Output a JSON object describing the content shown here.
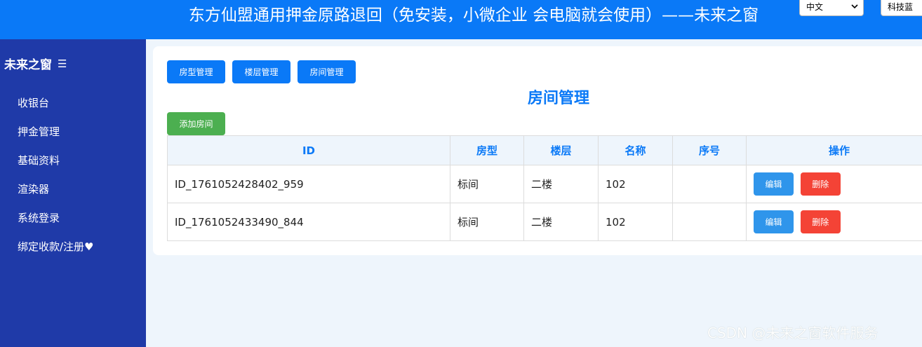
{
  "header": {
    "title": "东方仙盟通用押金原路退回（免安装，小微企业 会电脑就会使用）——未来之窗",
    "language_value": "中文",
    "theme_label": "科技蓝"
  },
  "sidebar": {
    "brand": "未来之窗",
    "menu_icon": "☰",
    "items": [
      {
        "label": "收银台"
      },
      {
        "label": "押金管理"
      },
      {
        "label": "基础资料"
      },
      {
        "label": "渲染器"
      },
      {
        "label": "系统登录"
      },
      {
        "label": "绑定收款/注册♥"
      }
    ]
  },
  "main": {
    "tabs": [
      {
        "label": "房型管理"
      },
      {
        "label": "楼层管理"
      },
      {
        "label": "房间管理"
      }
    ],
    "page_title": "房间管理",
    "add_button": "添加房间",
    "table": {
      "headers": [
        "ID",
        "房型",
        "楼层",
        "名称",
        "序号",
        "操作"
      ],
      "rows": [
        {
          "id": "ID_1761052428402_959",
          "room_type": "标间",
          "floor": "二楼",
          "name": "102",
          "seq": "",
          "edit": "编辑",
          "delete": "删除"
        },
        {
          "id": "ID_1761052433490_844",
          "room_type": "标间",
          "floor": "二楼",
          "name": "102",
          "seq": "",
          "edit": "编辑",
          "delete": "删除"
        }
      ]
    }
  },
  "watermark": "CSDN @未来之窗软件服务",
  "colors": {
    "primary": "#0a79f7",
    "sidebar": "#1f3aa8",
    "success": "#4caf50",
    "danger": "#f44336",
    "edit": "#2f95eb",
    "background": "#eef5fc"
  }
}
